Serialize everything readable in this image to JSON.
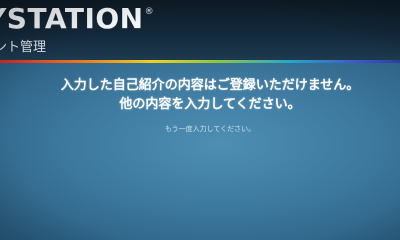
{
  "header": {
    "brand": "YSTATION",
    "brand_mark": "®",
    "section_title": "ント管理"
  },
  "dialog": {
    "message_line1": "入力した自己紹介の内容はご登録いただけません。",
    "message_line2": "他の内容を入力してください。",
    "hint": "もう一度入力してください。"
  },
  "colors": {
    "background": "#3e7aa0",
    "header": "#13283a",
    "text": "#ffffff"
  }
}
